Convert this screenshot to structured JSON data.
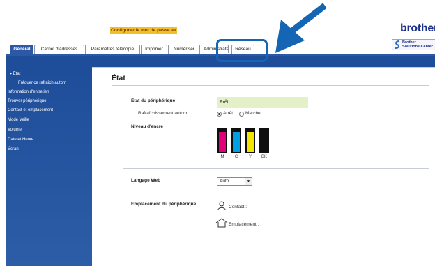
{
  "header": {
    "password_link": "Configurez le mot de passe >>",
    "logo": "brother",
    "solutions_center": "Brother\nSolutions Center"
  },
  "tabs": [
    {
      "label": "Général",
      "active": true
    },
    {
      "label": "Carnet d'adresses",
      "active": false
    },
    {
      "label": "Paramètres télécopie",
      "active": false
    },
    {
      "label": "Imprimer",
      "active": false
    },
    {
      "label": "Numériser",
      "active": false
    },
    {
      "label": "Administrateur",
      "active": false
    },
    {
      "label": "Réseau",
      "active": false
    }
  ],
  "sidebar": {
    "items": [
      {
        "label": "▸ État",
        "active": true
      },
      {
        "label": "Fréquence rafraîch autom",
        "sub": true
      },
      {
        "label": "Information d'entretien"
      },
      {
        "label": "Trouver périphérique"
      },
      {
        "label": "Contact et emplacement"
      },
      {
        "label": "Mode Veille"
      },
      {
        "label": "Volume"
      },
      {
        "label": "Date et Heure"
      },
      {
        "label": "Écran"
      }
    ]
  },
  "main": {
    "title": "État",
    "device_status": {
      "label": "État du périphérique",
      "value": "Prêt"
    },
    "auto_refresh": {
      "label": "Rafraîchissement autom",
      "options": [
        "Arrêt",
        "Marche"
      ],
      "selected": "Arrêt"
    },
    "ink_level": {
      "label": "Niveau d'encre",
      "cartridges": [
        {
          "name": "M",
          "color": "#e0007a"
        },
        {
          "name": "C",
          "color": "#00a0e3"
        },
        {
          "name": "Y",
          "color": "#f5e600"
        },
        {
          "name": "BK",
          "color": "#0f0f0f"
        }
      ]
    },
    "web_language": {
      "label": "Langage Web",
      "value": "Auto"
    },
    "device_location": {
      "label": "Emplacement du périphérique",
      "contact": "Contact :",
      "location": "Emplacement :"
    }
  },
  "colors": {
    "accent_blue": "#1e4d9a",
    "callout_blue": "#1565b5",
    "status_green": "#e4f1c8",
    "password_yellow": "#f0c028"
  }
}
